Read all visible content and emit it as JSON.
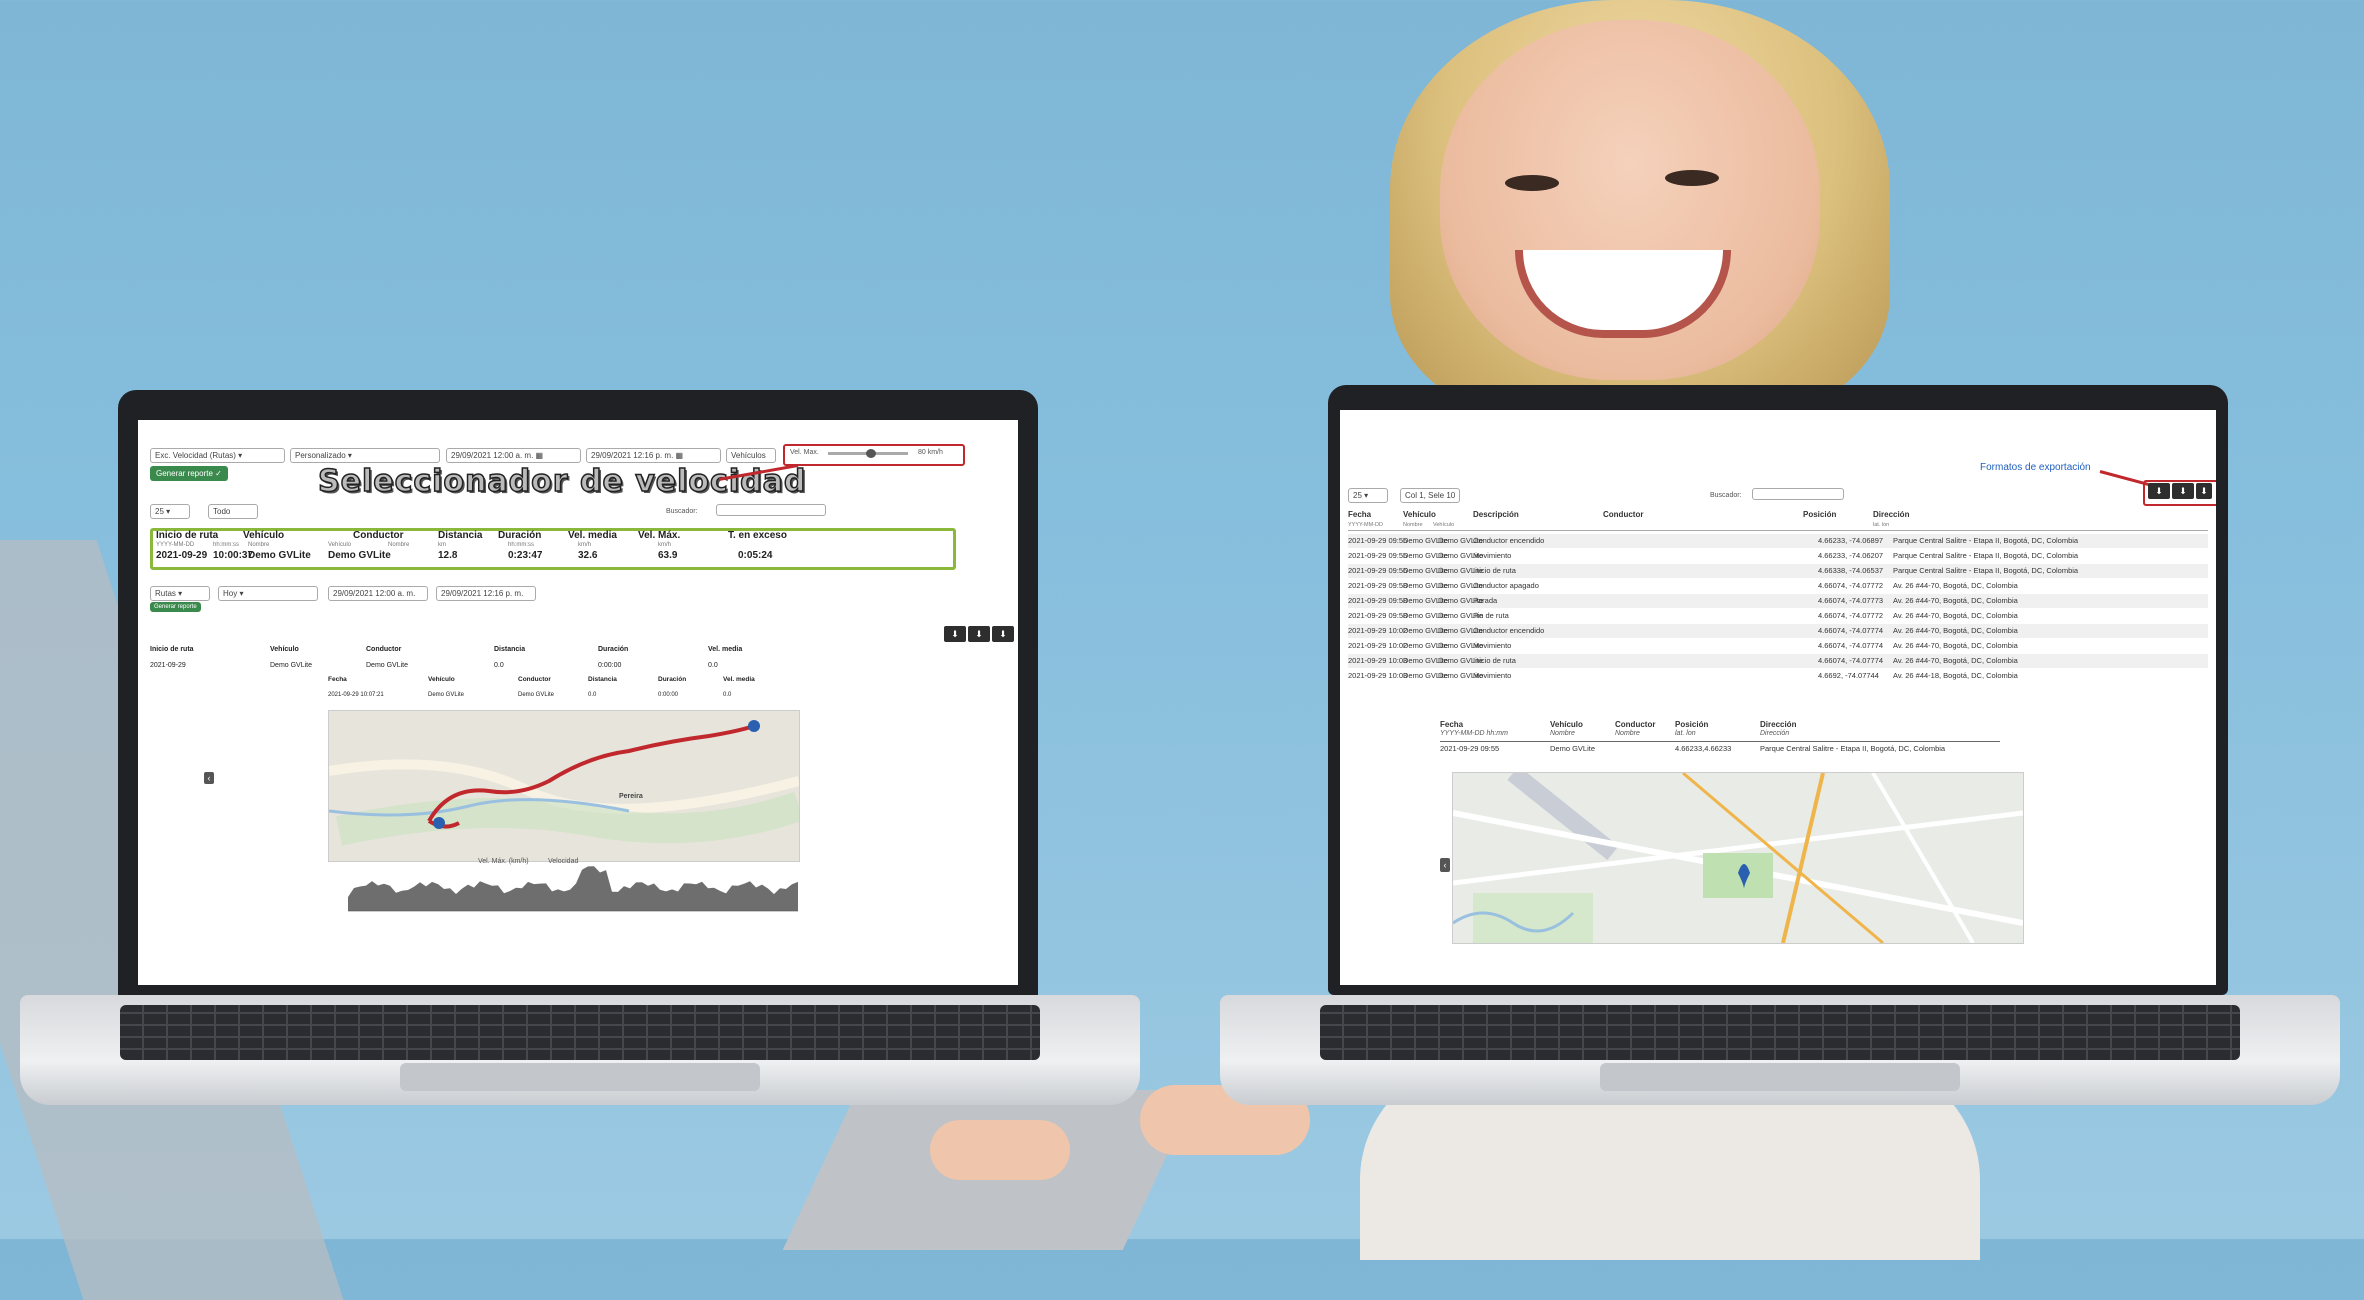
{
  "left_app": {
    "report_select": "Exc. Velocidad (Rutas)",
    "period_select": "Personalizado",
    "date_from": "29/09/2021 12:00 a. m.",
    "date_to": "29/09/2021 12:16 p. m.",
    "vehicles_label": "Vehículos",
    "speed_filter_label": "Vel. Max.",
    "speed_filter_value": "80 km/h",
    "generate_button": "Generar reporte",
    "overlay_heading": "Seleccionador de velocidad",
    "page_size": "25",
    "columns_button": "Todo",
    "search_label": "Buscador:",
    "summary_headers": [
      "Inicio de ruta",
      "Vehículo",
      "Conductor",
      "Distancia",
      "Duración",
      "Vel. media",
      "Vel. Máx.",
      "T. en exceso"
    ],
    "summary_row": [
      "2021-09-29",
      "10:00:37",
      "Demo GVLite",
      "Demo GVLite",
      "12.8",
      "0:23:47",
      "32.6",
      "63.9",
      "0:05:24"
    ],
    "summary_units": [
      "YYYY-MM-DD",
      "hh:mm:ss",
      "Nombre",
      "Vehículo",
      "Nombre",
      "km",
      "hh:mm:ss",
      "km/h",
      "km/h"
    ],
    "detail_headers": [
      "Inicio de ruta",
      "Vehículo",
      "Conductor",
      "Distancia",
      "Duración",
      "Vel. media"
    ],
    "detail_row": [
      "2021-09-29",
      "Demo GVLite",
      "Demo GVLite",
      "0.0",
      "0:00:00",
      "0.0"
    ],
    "sub_headers": [
      "Fecha",
      "Vehículo",
      "Conductor",
      "Distancia",
      "Duración",
      "Vel. media"
    ],
    "sub_row": [
      "2021-09-29 10:07:21",
      "Demo GVLite",
      "Demo GVLite",
      "0.0",
      "0:00:00",
      "0.0"
    ],
    "map_city_label": "Pereira",
    "chart_legend": [
      "Vel. Máx. (km/h)",
      "Velocidad"
    ]
  },
  "right_app": {
    "export_link": "Formatos de exportación",
    "page_size": "25",
    "columns_button": "Col 1, Sele 10",
    "search_label": "Buscador:",
    "headers": [
      "Fecha",
      "Vehículo",
      "Descripción",
      "Conductor",
      "Posición",
      "Dirección"
    ],
    "subheaders": [
      "YYYY-MM-DD",
      "Nombre",
      "Vehículo",
      "",
      "",
      "lat. lon"
    ],
    "rows": [
      [
        "2021-09-29 09:55",
        "Demo GVLite",
        "Demo GVLite",
        "Conductor encendido",
        "4.66233, -74.06897",
        "Parque Central Salitre - Etapa II, Bogotá, DC, Colombia"
      ],
      [
        "2021-09-29 09:55",
        "Demo GVLite",
        "Demo GVLite",
        "Movimiento",
        "4.66233, -74.06207",
        "Parque Central Salitre - Etapa II, Bogotá, DC, Colombia"
      ],
      [
        "2021-09-29 09:56",
        "Demo GVLite",
        "Demo GVLite",
        "Inicio de ruta",
        "4.66338, -74.06537",
        "Parque Central Salitre - Etapa II, Bogotá, DC, Colombia"
      ],
      [
        "2021-09-29 09:58",
        "Demo GVLite",
        "Demo GVLite",
        "Conductor apagado",
        "4.66074, -74.07772",
        "Av. 26 #44-70, Bogotá, DC, Colombia"
      ],
      [
        "2021-09-29 09:58",
        "Demo GVLite",
        "Demo GVLite",
        "Parada",
        "4.66074, -74.07773",
        "Av. 26 #44-70, Bogotá, DC, Colombia"
      ],
      [
        "2021-09-29 09:58",
        "Demo GVLite",
        "Demo GVLite",
        "Fin de ruta",
        "4.66074, -74.07772",
        "Av. 26 #44-70, Bogotá, DC, Colombia"
      ],
      [
        "2021-09-29 10:02",
        "Demo GVLite",
        "Demo GVLite",
        "Conductor encendido",
        "4.66074, -74.07774",
        "Av. 26 #44-70, Bogotá, DC, Colombia"
      ],
      [
        "2021-09-29 10:02",
        "Demo GVLite",
        "Demo GVLite",
        "Movimiento",
        "4.66074, -74.07774",
        "Av. 26 #44-70, Bogotá, DC, Colombia"
      ],
      [
        "2021-09-29 10:03",
        "Demo GVLite",
        "Demo GVLite",
        "Inicio de ruta",
        "4.66074, -74.07774",
        "Av. 26 #44-70, Bogotá, DC, Colombia"
      ],
      [
        "2021-09-29 10:03",
        "Demo GVLite",
        "Demo GVLite",
        "Movimiento",
        "4.6692, -74.07744",
        "Av. 26 #44-18, Bogotá, DC, Colombia"
      ]
    ],
    "detail_headers": [
      "Fecha",
      "Vehículo",
      "Conductor",
      "Posición",
      "Dirección"
    ],
    "detail_subheaders": [
      "YYYY-MM-DD hh:mm",
      "Nombre",
      "Nombre",
      "lat. lon",
      "Dirección"
    ],
    "detail_row": [
      "2021-09-29 09:55",
      "Demo GVLite",
      "",
      "4.66233,4.66233",
      "Parque Central Salitre - Etapa II, Bogotá, DC, Colombia"
    ]
  }
}
